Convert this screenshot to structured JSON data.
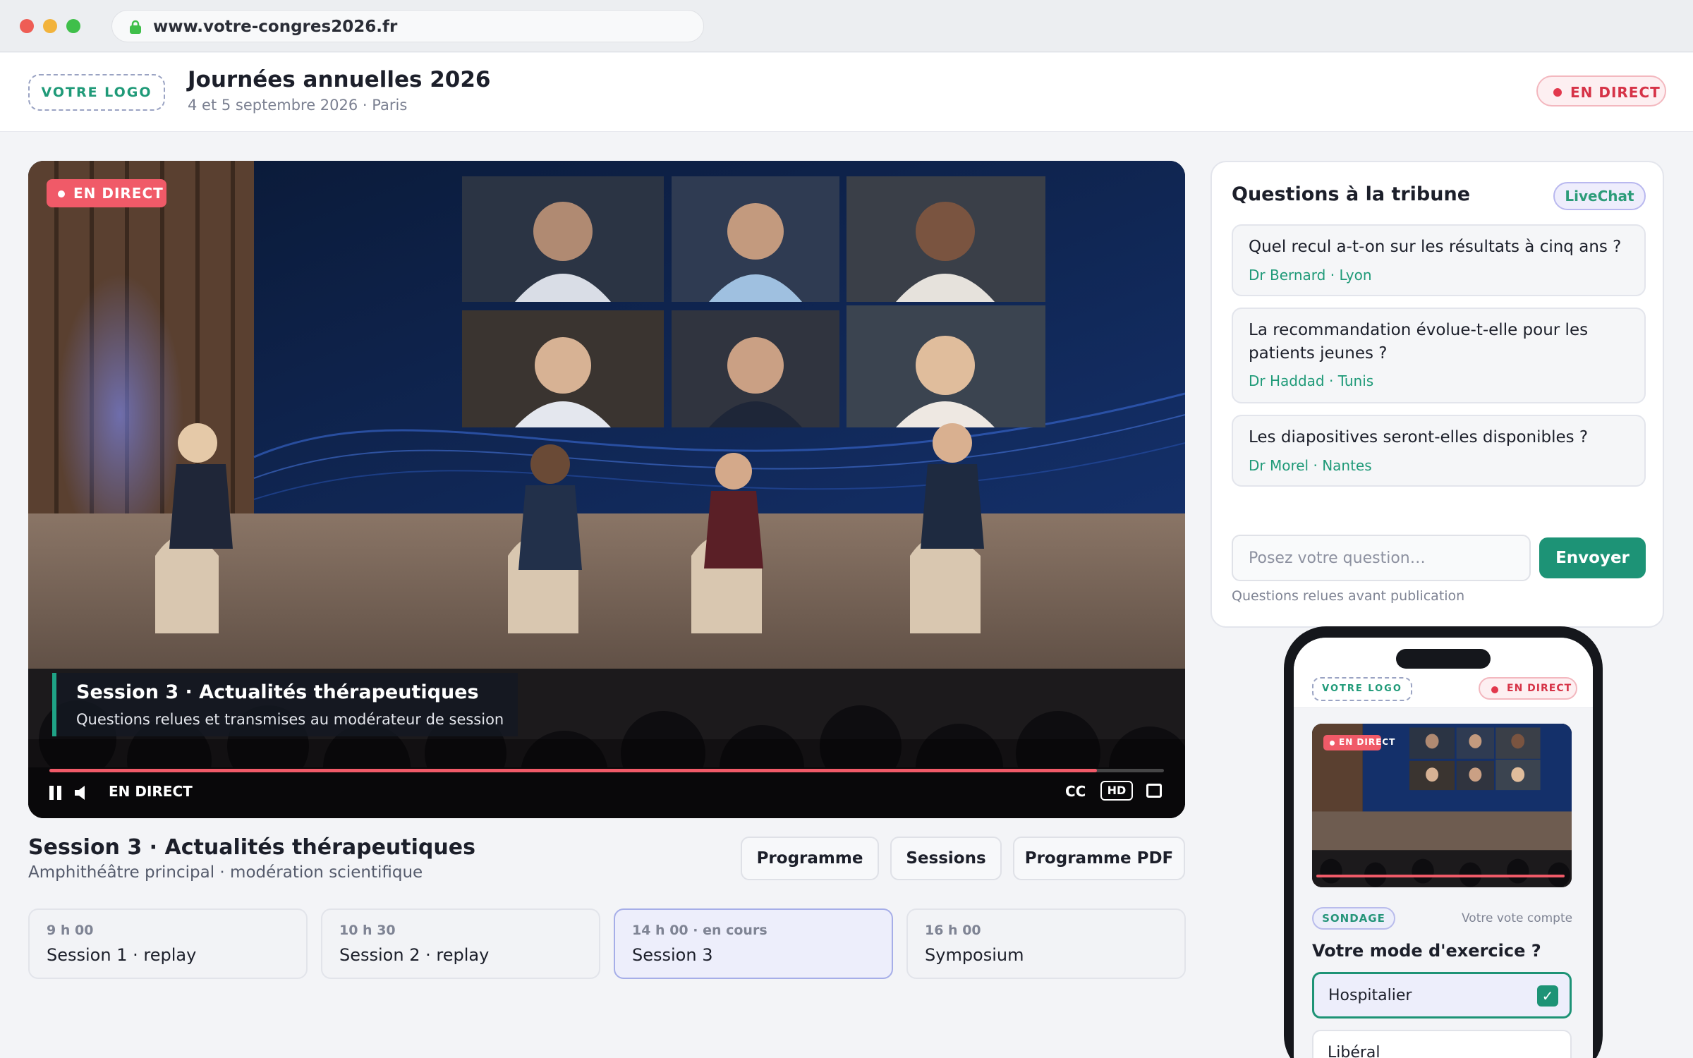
{
  "browser": {
    "url": "www.votre-congres2026.fr"
  },
  "header": {
    "logo": "VOTRE LOGO",
    "title": "Journées annuelles 2026",
    "subtitle": "4 et 5 septembre 2026 · Paris",
    "live_label": "EN DIRECT"
  },
  "player": {
    "badge": "EN DIRECT",
    "caption_title": "Session 3 · Actualités thérapeutiques",
    "caption_subtitle": "Questions relues et transmises au modérateur de session",
    "status": "EN DIRECT",
    "cc": "CC",
    "hd": "HD",
    "progress": 0.94
  },
  "session": {
    "title": "Session 3 · Actualités thérapeutiques",
    "subtitle": "Amphithéâtre principal · modération scientifique",
    "buttons": [
      "Programme",
      "Sessions",
      "Programme PDF"
    ]
  },
  "schedule": [
    {
      "time": "9 h 00",
      "name": "Session 1 · replay",
      "active": false
    },
    {
      "time": "10 h 30",
      "name": "Session 2 · replay",
      "active": false
    },
    {
      "time": "14 h 00 · en cours",
      "name": "Session 3",
      "active": true
    },
    {
      "time": "16 h 00",
      "name": "Symposium",
      "active": false
    }
  ],
  "questions": {
    "title": "Questions à la tribune",
    "badge": "LiveChat",
    "items": [
      {
        "text": "Quel recul a-t-on sur les résultats à cinq ans ?",
        "author": "Dr Bernard · Lyon"
      },
      {
        "text": "La recommandation évolue-t-elle pour les patients jeunes ?",
        "author": "Dr Haddad · Tunis"
      },
      {
        "text": "Les diapositives seront-elles disponibles ?",
        "author": "Dr Morel · Nantes"
      }
    ],
    "input_placeholder": "Posez votre question…",
    "send_label": "Envoyer",
    "note": "Questions relues avant publication"
  },
  "phone": {
    "logo": "VOTRE LOGO",
    "live_label": "EN DIRECT",
    "video_badge": "EN DIRECT",
    "poll_badge": "SONDAGE",
    "poll_note": "Votre vote compte",
    "poll_question": "Votre mode d'exercice ?",
    "options": [
      {
        "label": "Hospitalier",
        "selected": true
      },
      {
        "label": "Libéral",
        "selected": false
      }
    ]
  },
  "colors": {
    "accent": "#1d9376",
    "live": "#e2384d",
    "active_card": "#edeefb"
  }
}
